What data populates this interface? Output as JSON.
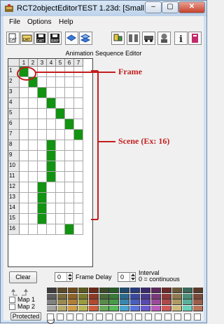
{
  "window": {
    "title": "RCT2objectEditorTEST 1.23d: [Small Scen...",
    "minimize_glyph": "–",
    "maximize_glyph": "▢",
    "close_glyph": "✕"
  },
  "menu": {
    "items": [
      "File",
      "Options",
      "Help"
    ]
  },
  "toolbar": {
    "icons": [
      "new-file-icon",
      "open-dat-icon",
      "save-dat-icon",
      "save-bmp-icon",
      "flip-blue-icon",
      "layers-blue-icon",
      "paint-icon",
      "parallel-gray-icon",
      "vehicle-icon",
      "robot-icon",
      "help-icon",
      "book-icon"
    ]
  },
  "editor": {
    "title": "Animation Sequence Editor",
    "columns": [
      "1",
      "2",
      "3",
      "4",
      "5",
      "6",
      "7"
    ],
    "rows": [
      "1",
      "2",
      "3",
      "4",
      "5",
      "6",
      "7",
      "8",
      "9",
      "10",
      "11",
      "12",
      "13",
      "14",
      "15",
      "16"
    ],
    "frames_on_per_row": [
      1,
      2,
      3,
      4,
      5,
      6,
      7,
      4,
      4,
      4,
      4,
      3,
      3,
      3,
      3,
      6
    ],
    "fill_color": "#129312"
  },
  "annotations": {
    "frame_label": "Frame",
    "scene_label": "Scene (Ex: 16)",
    "color": "#c31d1d"
  },
  "controls": {
    "clear_label": "Clear",
    "frame_delay_value": "0",
    "frame_delay_label": "Frame Delay",
    "interval_value": "0",
    "interval_label": "Interval",
    "interval_note": "0 = continuous",
    "map1_label": "Map 1",
    "map2_label": "Map 2",
    "protected_label": "Protected"
  },
  "palette": {
    "rows": [
      [
        "#3b3b3b",
        "#5a4a2a",
        "#6b4a1f",
        "#5a5a20",
        "#6a2a1a",
        "#3a4a2a",
        "#2a5a2a",
        "#1f4a6a",
        "#2a3a7a",
        "#3a2a6a",
        "#5a2a5a",
        "#6a2a2a",
        "#6a5a3a",
        "#3a6a5a",
        "#5a3a2a"
      ],
      [
        "#5e5e5e",
        "#7a6a3e",
        "#8e6328",
        "#7a7a2e",
        "#8e3a25",
        "#4a6a3a",
        "#3a7a3a",
        "#2a6a8e",
        "#3a4a9e",
        "#4a3a8e",
        "#7a3a7a",
        "#8e3a3a",
        "#8e7a4e",
        "#4a8e7a",
        "#7a4a3a"
      ],
      [
        "#828282",
        "#9a8a52",
        "#b07e36",
        "#9a9a3e",
        "#b04a30",
        "#5a8a4a",
        "#4a9a4a",
        "#3a86b0",
        "#4a5ebe",
        "#5a4ab0",
        "#9a4a9a",
        "#b04a4a",
        "#ae9a62",
        "#5ab09a",
        "#9a5e4a"
      ],
      [
        "#a4a4a4",
        "#b8aa6a",
        "#d09c48",
        "#b8b85a",
        "#d05e3e",
        "#6aaa5a",
        "#5aba5a",
        "#4aa4d0",
        "#5a74dc",
        "#6a5ad0",
        "#ba5aba",
        "#d05a5a",
        "#ceba7a",
        "#6ad0ba",
        "#ba745a"
      ]
    ]
  }
}
